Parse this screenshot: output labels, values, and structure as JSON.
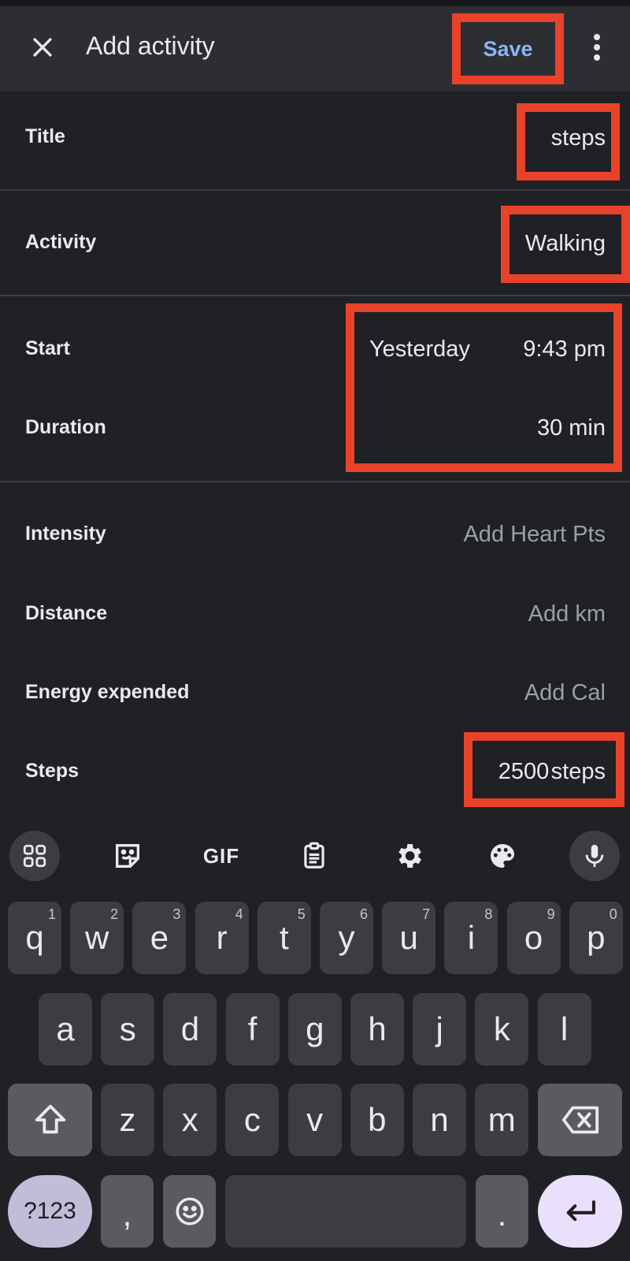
{
  "appbar": {
    "title": "Add activity",
    "save_label": "Save",
    "close_icon": "close-icon",
    "more_icon": "more-vert-icon"
  },
  "form": {
    "title": {
      "label": "Title",
      "value": "steps"
    },
    "activity": {
      "label": "Activity",
      "value": "Walking"
    },
    "start": {
      "label": "Start",
      "date": "Yesterday",
      "time": "9:43 pm"
    },
    "duration": {
      "label": "Duration",
      "value": "30 min"
    },
    "intensity": {
      "label": "Intensity",
      "placeholder": "Add Heart Pts"
    },
    "distance": {
      "label": "Distance",
      "placeholder": "Add km"
    },
    "energy": {
      "label": "Energy expended",
      "placeholder": "Add Cal"
    },
    "steps": {
      "label": "Steps",
      "value": "2500",
      "unit": "steps"
    }
  },
  "keyboard": {
    "toolbar": {
      "gif_label": "GIF",
      "icons": [
        "apps-grid-icon",
        "sticker-icon",
        "clipboard-icon",
        "settings-icon",
        "palette-icon",
        "mic-icon"
      ]
    },
    "row1": [
      {
        "k": "q",
        "h": "1"
      },
      {
        "k": "w",
        "h": "2"
      },
      {
        "k": "e",
        "h": "3"
      },
      {
        "k": "r",
        "h": "4"
      },
      {
        "k": "t",
        "h": "5"
      },
      {
        "k": "y",
        "h": "6"
      },
      {
        "k": "u",
        "h": "7"
      },
      {
        "k": "i",
        "h": "8"
      },
      {
        "k": "o",
        "h": "9"
      },
      {
        "k": "p",
        "h": "0"
      }
    ],
    "row2": [
      "a",
      "s",
      "d",
      "f",
      "g",
      "h",
      "j",
      "k",
      "l"
    ],
    "row3": [
      "z",
      "x",
      "c",
      "v",
      "b",
      "n",
      "m"
    ],
    "symbols_label": "?123",
    "comma_label": ",",
    "period_label": "."
  },
  "colors": {
    "highlight": "#e8432a",
    "accent": "#8ab4f8",
    "background": "#202124",
    "appbar": "#2d2e31"
  }
}
